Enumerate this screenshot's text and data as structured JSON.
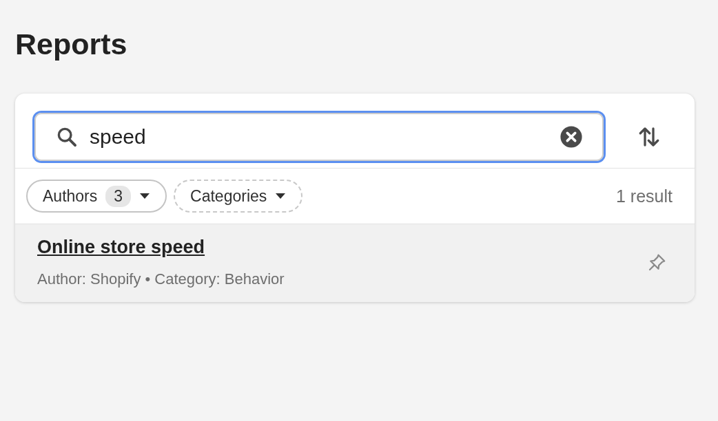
{
  "page": {
    "title": "Reports"
  },
  "search": {
    "value": "speed"
  },
  "filters": [
    {
      "label": "Authors",
      "count": "3",
      "applied": true
    },
    {
      "label": "Categories",
      "applied": false
    }
  ],
  "result_count": "1 result",
  "reports": [
    {
      "title": "Online store speed",
      "meta": "Author: Shopify • Category: Behavior",
      "hovered": true
    }
  ]
}
